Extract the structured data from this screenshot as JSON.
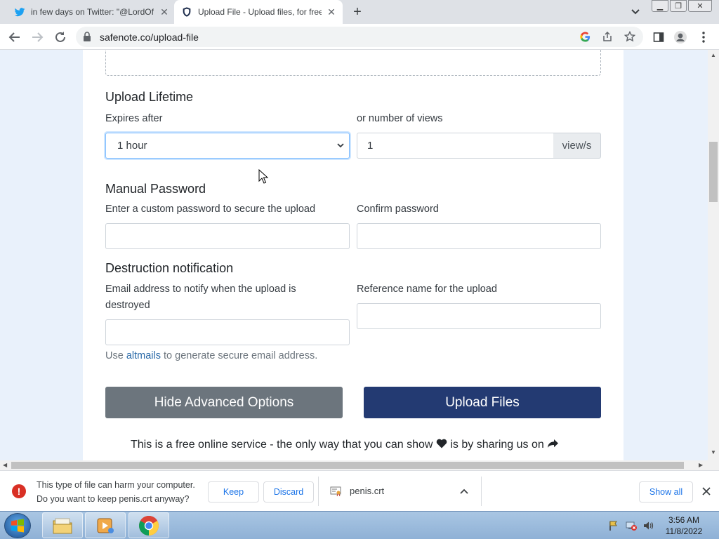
{
  "browser": {
    "tabs": [
      {
        "title": "in few days on Twitter: \"@LordOfPeng",
        "icon": "twitter-icon"
      },
      {
        "title": "Upload File - Upload files, for free",
        "icon": "shield-icon"
      }
    ],
    "address": "safenote.co/upload-file"
  },
  "form": {
    "lifetime": {
      "heading": "Upload Lifetime",
      "expires_label": "Expires after",
      "expires_value": "1 hour",
      "views_label": "or number of views",
      "views_value": "1",
      "views_suffix": "view/s"
    },
    "password": {
      "heading": "Manual Password",
      "label": "Enter a custom password to secure the upload",
      "confirm_label": "Confirm password"
    },
    "notification": {
      "heading": "Destruction notification",
      "email_label_line1": "Email address to notify when the upload is",
      "email_label_line2": "destroyed",
      "reference_label": "Reference name for the upload",
      "help_prefix": "Use",
      "help_link": "altmails",
      "help_suffix": "to generate secure email address."
    },
    "buttons": {
      "hide_advanced": "Hide Advanced Options",
      "upload": "Upload Files"
    },
    "footer_before": "This is a free online service - the only way that you can show",
    "footer_after": "is by sharing us on"
  },
  "download_bar": {
    "warning_line1": "This type of file can harm your computer.",
    "warning_line2": "Do you want to keep penis.crt anyway?",
    "keep": "Keep",
    "discard": "Discard",
    "filename": "penis.crt",
    "show_all": "Show all"
  },
  "taskbar": {
    "time": "3:56 AM",
    "date": "11/8/2022"
  },
  "colors": {
    "upload_button": "#233a72",
    "hide_button": "#6c757d",
    "warning": "#d93025"
  }
}
